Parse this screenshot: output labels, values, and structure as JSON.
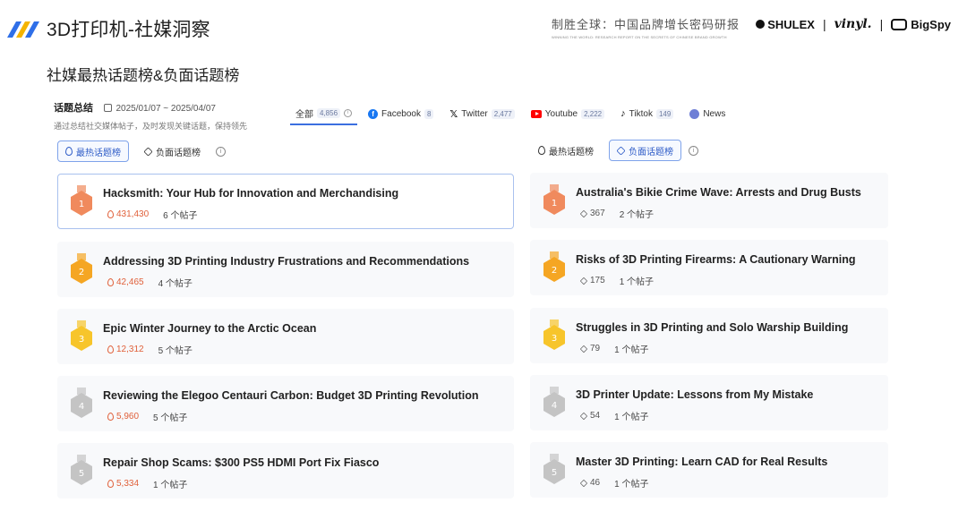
{
  "header": {
    "app_title": "3D打印机-社媒洞察",
    "tagline_main": "制胜全球：中国品牌增长密码研报",
    "tagline_sub": "WINNING THE WORLD: RESEARCH REPORT ON THE SECRETS OF CHINESE BRAND GROWTH",
    "brands": [
      "SHULEX",
      "vinyl.",
      "BigSpy"
    ],
    "separator": "|"
  },
  "section_title": "社媒最热话题榜&负面话题榜",
  "panel": {
    "title": "话题总结",
    "date_range": "2025/01/07 ~ 2025/04/07",
    "description": "通过总结社交媒体帖子，及时发现关键话题，保持领先"
  },
  "tabs": [
    {
      "label": "全部",
      "count": "4,856",
      "icon": "info-icon"
    },
    {
      "label": "Facebook",
      "count": "8",
      "icon": "facebook-icon"
    },
    {
      "label": "Twitter",
      "count": "2,477",
      "icon": "x-icon"
    },
    {
      "label": "Youtube",
      "count": "2,222",
      "icon": "youtube-icon"
    },
    {
      "label": "Tiktok",
      "count": "149",
      "icon": "tiktok-icon"
    },
    {
      "label": "News",
      "count": "",
      "icon": "news-icon"
    }
  ],
  "toggles": {
    "hot_label": "最热话题榜",
    "negative_label": "负面话题榜",
    "info": "i"
  },
  "hot_topics": [
    {
      "rank": "1",
      "title": "Hacksmith: Your Hub for Innovation and Merchandising",
      "metric": "431,430",
      "posts": "6 个帖子"
    },
    {
      "rank": "2",
      "title": "Addressing 3D Printing Industry Frustrations and Recommendations",
      "metric": "42,465",
      "posts": "4 个帖子"
    },
    {
      "rank": "3",
      "title": "Epic Winter Journey to the Arctic Ocean",
      "metric": "12,312",
      "posts": "5 个帖子"
    },
    {
      "rank": "4",
      "title": "Reviewing the Elegoo Centauri Carbon: Budget 3D Printing Revolution",
      "metric": "5,960",
      "posts": "5 个帖子"
    },
    {
      "rank": "5",
      "title": "Repair Shop Scams: $300 PS5 HDMI Port Fix Fiasco",
      "metric": "5,334",
      "posts": "1 个帖子"
    }
  ],
  "negative_topics": [
    {
      "rank": "1",
      "title": "Australia's Bikie Crime Wave: Arrests and Drug Busts",
      "metric": "367",
      "posts": "2 个帖子"
    },
    {
      "rank": "2",
      "title": "Risks of 3D Printing Firearms: A Cautionary Warning",
      "metric": "175",
      "posts": "1 个帖子"
    },
    {
      "rank": "3",
      "title": "Struggles in 3D Printing and Solo Warship Building",
      "metric": "79",
      "posts": "1 个帖子"
    },
    {
      "rank": "4",
      "title": "3D Printer Update: Lessons from My Mistake",
      "metric": "54",
      "posts": "1 个帖子"
    },
    {
      "rank": "5",
      "title": "Master 3D Printing: Learn CAD for Real Results",
      "metric": "46",
      "posts": "1 个帖子"
    }
  ],
  "colors": {
    "accent": "#3b6fe0",
    "hot_metric": "#e0603a",
    "medal_1": "#f08a5d",
    "medal_2": "#f5a623",
    "medal_3": "#f7c52b",
    "medal_4": "#c4c4c4",
    "medal_5": "#c4c4c4"
  }
}
